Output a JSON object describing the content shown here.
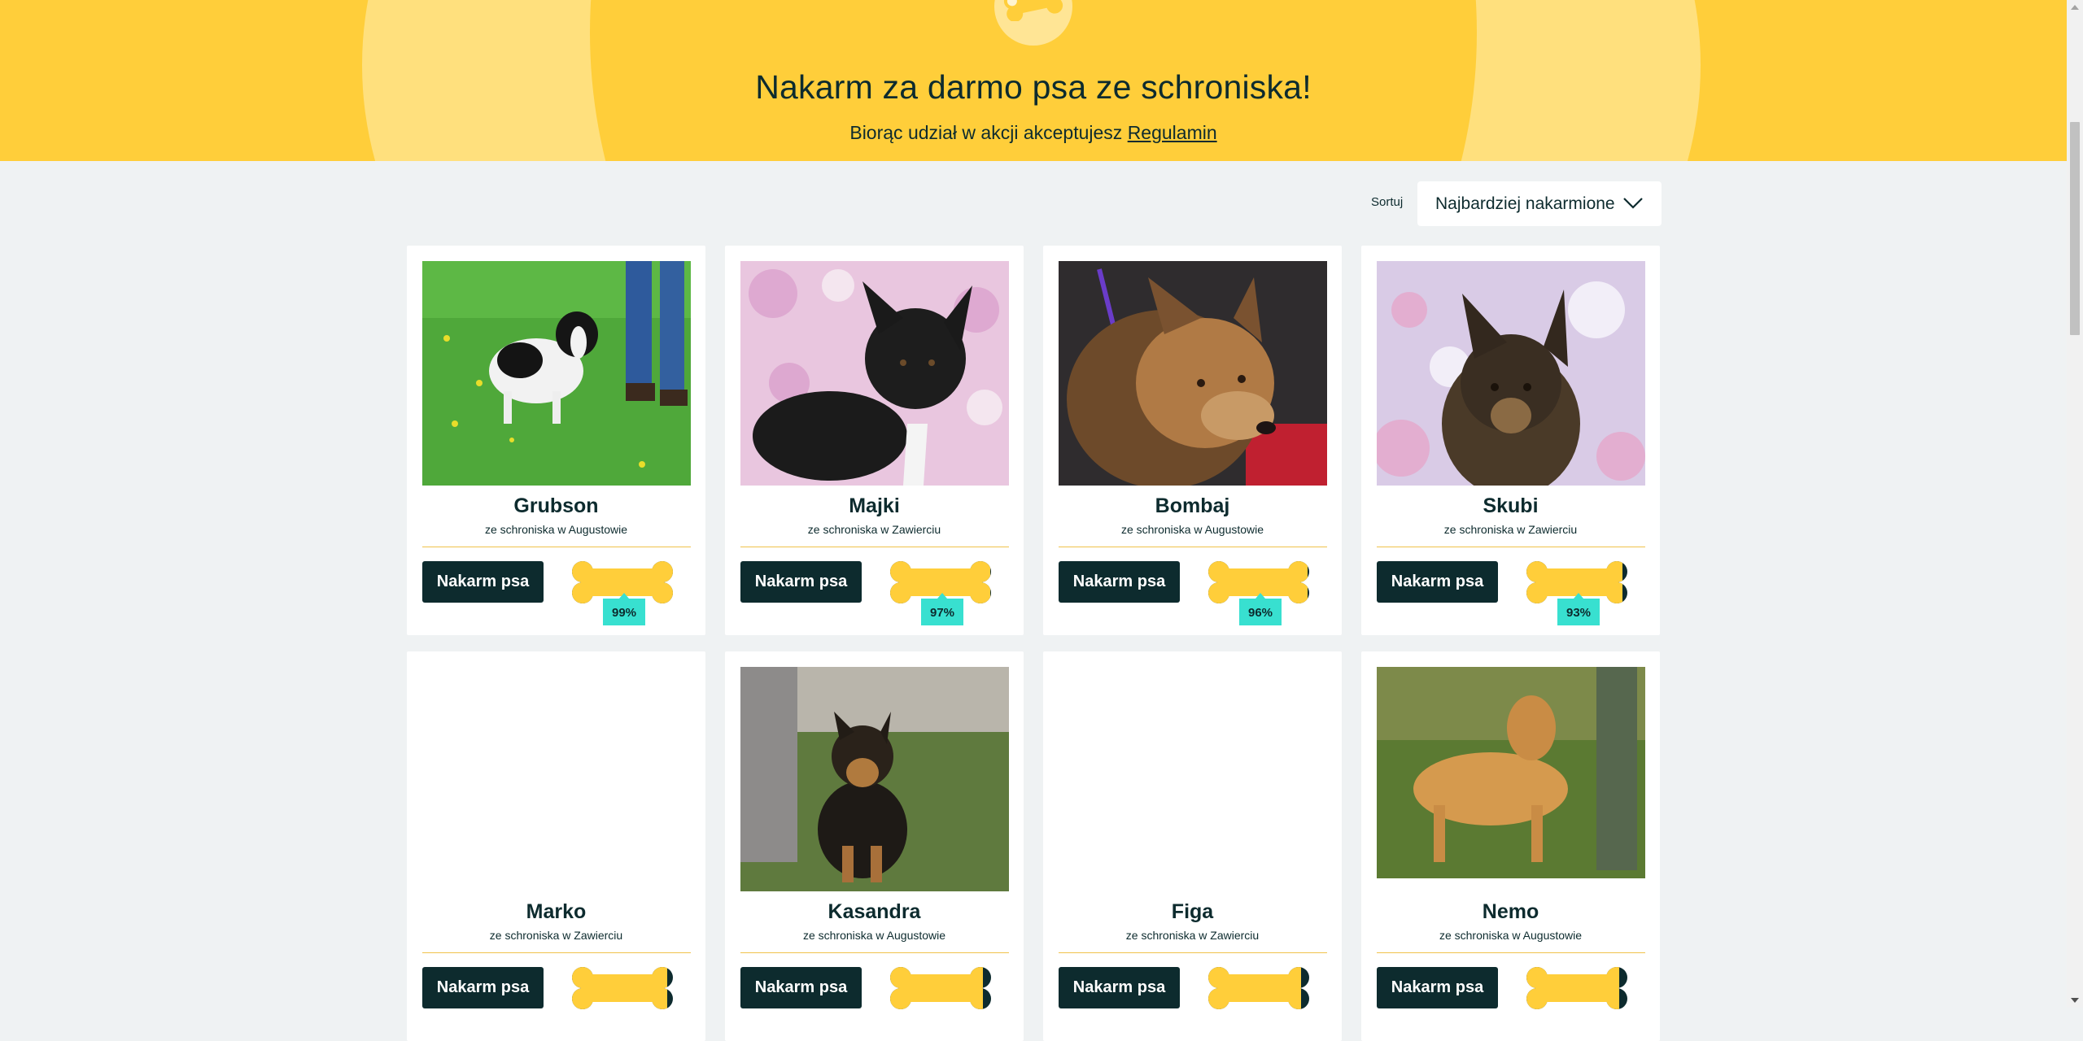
{
  "hero": {
    "title": "Nakarm za darmo psa ze schroniska!",
    "subtitle_prefix": "Biorąc udział w akcji akceptujesz",
    "terms_link": "Regulamin"
  },
  "sort": {
    "label": "Sortuj",
    "selected": "Najbardziej nakarmione"
  },
  "colors": {
    "banner": "#ffce3a",
    "dark": "#0d2b2e",
    "percent_badge": "#38e0d0",
    "bone": "#ffce3a"
  },
  "dogs": [
    {
      "name": "Grubson",
      "shelter": "ze schroniska w Augustowie",
      "button": "Nakarm psa",
      "fed_percent": 99,
      "fed_label": "99%",
      "photo": "grass-bw"
    },
    {
      "name": "Majki",
      "shelter": "ze schroniska w Zawierciu",
      "button": "Nakarm psa",
      "fed_percent": 97,
      "fed_label": "97%",
      "photo": "pink-black"
    },
    {
      "name": "Bombaj",
      "shelter": "ze schroniska w Augustowie",
      "button": "Nakarm psa",
      "fed_percent": 96,
      "fed_label": "96%",
      "photo": "dark-tan"
    },
    {
      "name": "Skubi",
      "shelter": "ze schroniska w Zawierciu",
      "button": "Nakarm psa",
      "fed_percent": 93,
      "fed_label": "93%",
      "photo": "pink-dark"
    },
    {
      "name": "Marko",
      "shelter": "ze schroniska w Zawierciu",
      "button": "Nakarm psa",
      "fed_percent": 92,
      "photo": "blank"
    },
    {
      "name": "Kasandra",
      "shelter": "ze schroniska w Augustowie",
      "button": "Nakarm psa",
      "fed_percent": 90,
      "photo": "grass-dark"
    },
    {
      "name": "Figa",
      "shelter": "ze schroniska w Zawierciu",
      "button": "Nakarm psa",
      "fed_percent": 90,
      "photo": "blank"
    },
    {
      "name": "Nemo",
      "shelter": "ze schroniska w Augustowie",
      "button": "Nakarm psa",
      "fed_percent": 90,
      "photo": "tan-grass"
    }
  ]
}
